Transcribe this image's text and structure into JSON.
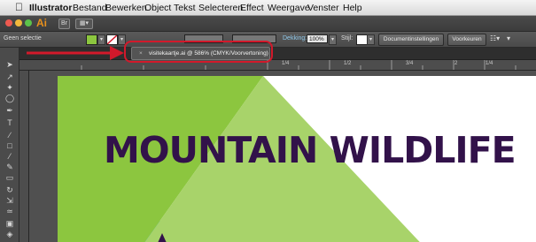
{
  "menubar": {
    "app_name": "Illustrator",
    "items": [
      "Bestand",
      "Bewerken",
      "Object",
      "Tekst",
      "Selecteren",
      "Effect",
      "Weergave",
      "Venster",
      "Help"
    ]
  },
  "appbar": {
    "logo": "Ai"
  },
  "control_panel": {
    "selection_label": "Geen selectie",
    "opacity_label": "Dekking:",
    "opacity_value": "100%",
    "style_label": "Stijl:",
    "document_settings_button": "Documentinstellingen",
    "preferences_button": "Voorkeuren",
    "fill_color": "#8cc63f",
    "stroke_color": "#ffffff"
  },
  "document_tab": {
    "title": "visitekaartje.ai @ 586% (CMYK/Voorvertoning)"
  },
  "ruler": {
    "ticks": [
      "1/4",
      "1/2",
      "3/4",
      "2",
      "1/4"
    ]
  },
  "artwork": {
    "headline": "MOUNTAIN WILDLIFE",
    "colors": {
      "cyan": "#1aa8e2",
      "green": "#8cc63f",
      "light_green": "#a8d36a",
      "purple": "#32124a"
    }
  },
  "annotation": {
    "highlight_color": "#d2192b"
  }
}
